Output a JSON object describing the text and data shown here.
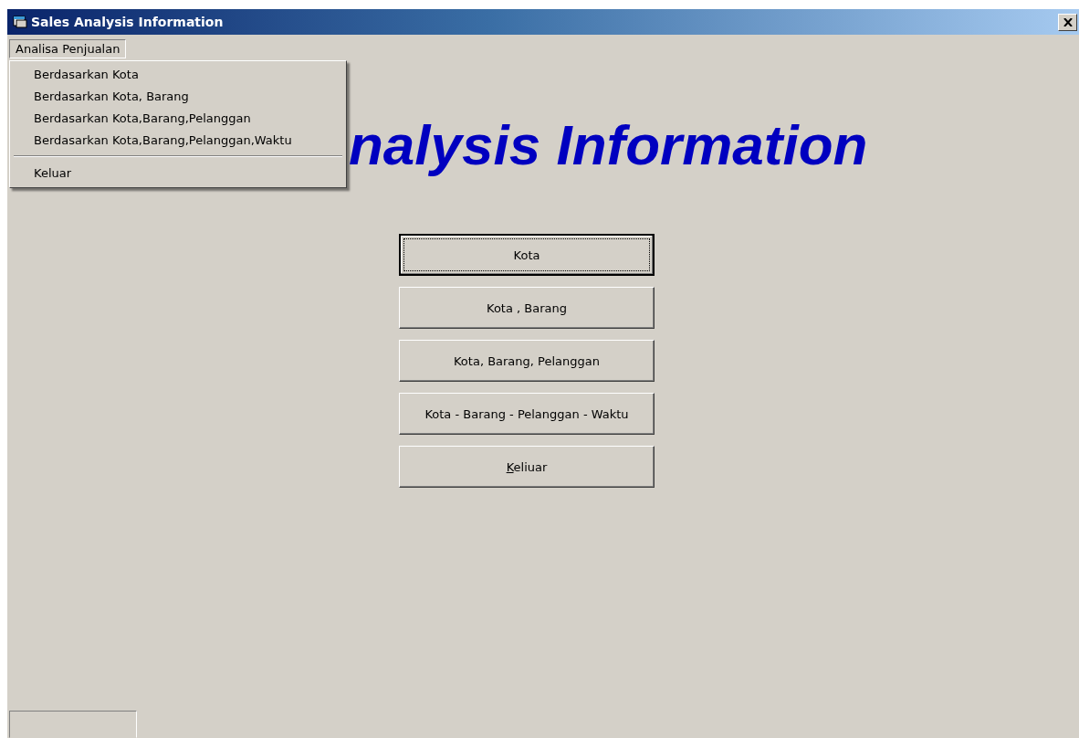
{
  "window": {
    "title": "Sales Analysis Information"
  },
  "menu_bar": [
    {
      "label": "Analisa Penjualan",
      "open": true
    }
  ],
  "menu_items": [
    {
      "label": "Berdasarkan Kota",
      "separator_before": false
    },
    {
      "label": "Berdasarkan Kota, Barang",
      "separator_before": false
    },
    {
      "label": "Berdasarkan Kota,Barang,Pelanggan",
      "separator_before": false
    },
    {
      "label": "Berdasarkan Kota,Barang,Pelanggan,Waktu",
      "separator_before": false
    },
    {
      "label": "Keluar",
      "separator_before": true
    }
  ],
  "heading": "nalysis Information",
  "buttons": [
    {
      "label": "Kota",
      "focused": true,
      "mnemonic_underline": false
    },
    {
      "label": "Kota , Barang",
      "focused": false,
      "mnemonic_underline": false
    },
    {
      "label": "Kota, Barang, Pelanggan",
      "focused": false,
      "mnemonic_underline": false
    },
    {
      "label": "Kota - Barang - Pelanggan - Waktu",
      "focused": false,
      "mnemonic_underline": false
    },
    {
      "label": "Keliuar",
      "focused": false,
      "mnemonic_underline": true
    }
  ]
}
